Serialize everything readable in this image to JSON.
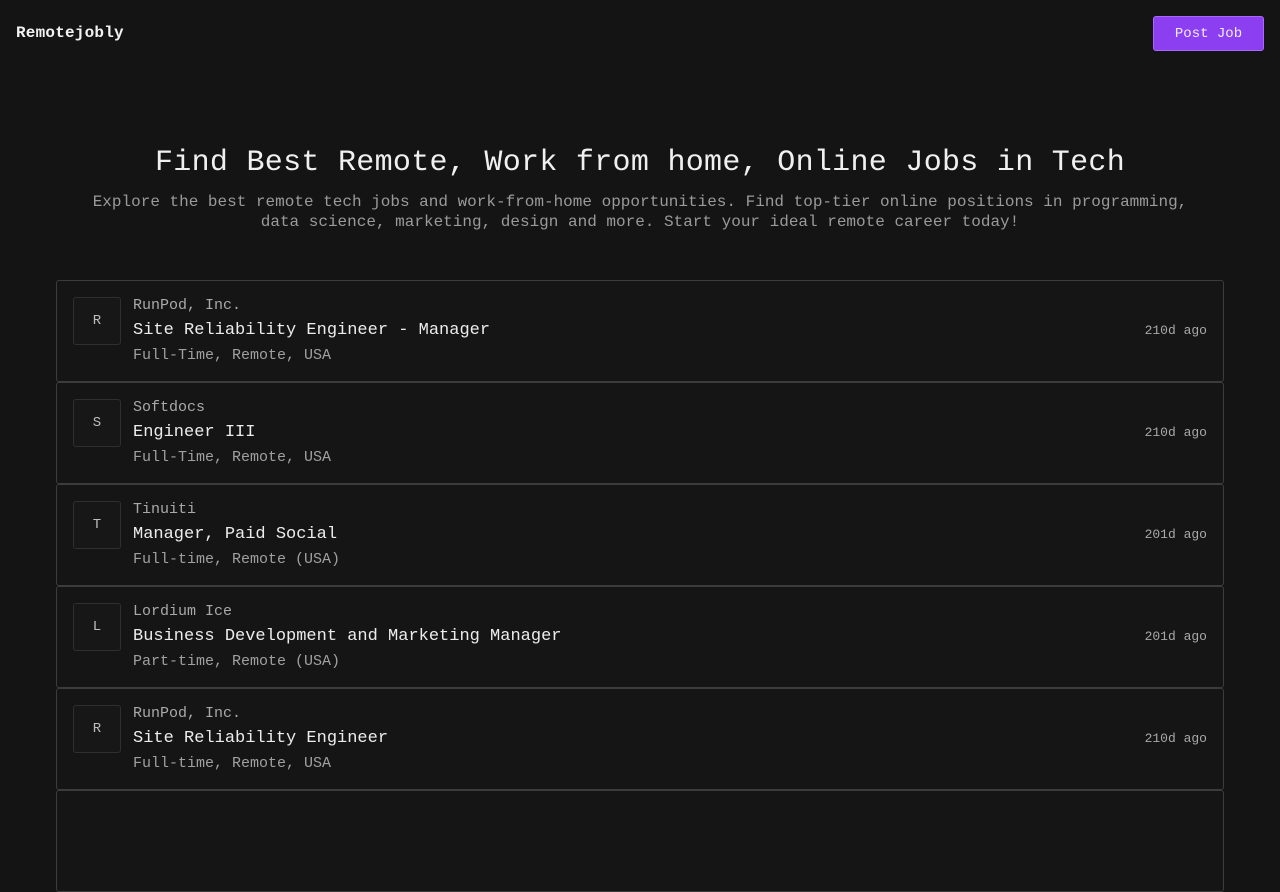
{
  "header": {
    "logo": "Remotejobly",
    "post_job_label": "Post Job",
    "accent_color": "#8b3ff0"
  },
  "hero": {
    "title": "Find Best Remote, Work from home, Online Jobs in Tech",
    "subtitle": "Explore the best remote tech jobs and work-from-home opportunities. Find top-tier online positions in programming, data science, marketing, design and more. Start your ideal remote career today!"
  },
  "jobs": [
    {
      "initial": "R",
      "company": "RunPod, Inc.",
      "title": "Site Reliability Engineer - Manager",
      "meta": "Full-Time, Remote, USA",
      "age": "210d ago"
    },
    {
      "initial": "S",
      "company": "Softdocs",
      "title": "Engineer III",
      "meta": "Full-Time, Remote, USA",
      "age": "210d ago"
    },
    {
      "initial": "T",
      "company": "Tinuiti",
      "title": "Manager, Paid Social",
      "meta": "Full-time, Remote (USA)",
      "age": "201d ago"
    },
    {
      "initial": "L",
      "company": "Lordium Ice",
      "title": "Business Development and Marketing Manager",
      "meta": "Part-time, Remote (USA)",
      "age": "201d ago"
    },
    {
      "initial": "R",
      "company": "RunPod, Inc.",
      "title": "Site Reliability Engineer",
      "meta": "Full-time, Remote, USA",
      "age": "210d ago"
    },
    {
      "initial": "",
      "company": "",
      "title": "",
      "meta": "",
      "age": ""
    }
  ]
}
